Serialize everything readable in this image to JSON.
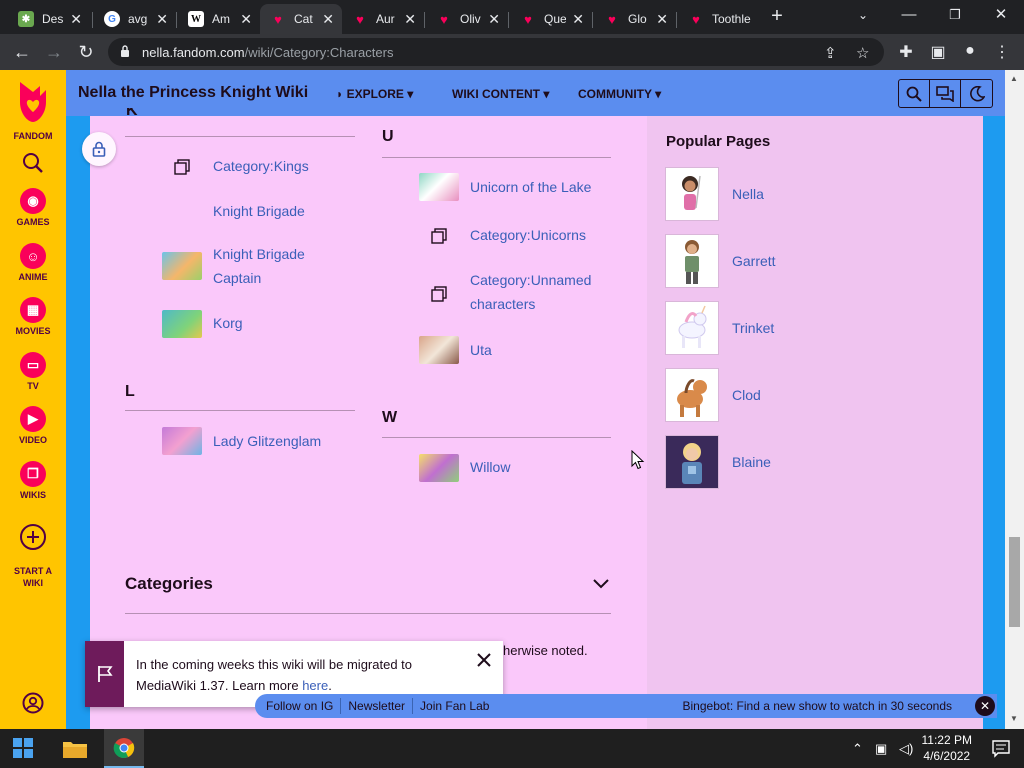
{
  "browser": {
    "tabs": [
      {
        "label": "Des",
        "fav_color": "#6aa84f",
        "fav_glyph": "✱"
      },
      {
        "label": "avg",
        "fav_color": "#ffffff",
        "fav_glyph": "G"
      },
      {
        "label": "Am",
        "fav_color": "#ffffff",
        "fav_glyph": "W"
      },
      {
        "label": "Cat",
        "fav_color": "#fa005a",
        "fav_glyph": "♥",
        "active": true
      },
      {
        "label": "Aur",
        "fav_color": "#fa005a",
        "fav_glyph": "♥"
      },
      {
        "label": "Oliv",
        "fav_color": "#fa005a",
        "fav_glyph": "♥"
      },
      {
        "label": "Que",
        "fav_color": "#fa005a",
        "fav_glyph": "♥"
      },
      {
        "label": "Glo",
        "fav_color": "#fa005a",
        "fav_glyph": "♥"
      },
      {
        "label": "Toothle",
        "fav_color": "#fa005a",
        "fav_glyph": "♥"
      }
    ],
    "url_host": "nella.fandom.com",
    "url_path": "/wiki/Category:Characters"
  },
  "rail": {
    "logo_label": "FANDOM",
    "items": [
      {
        "label": "GAMES"
      },
      {
        "label": "ANIME"
      },
      {
        "label": "MOVIES"
      },
      {
        "label": "TV"
      },
      {
        "label": "VIDEO"
      },
      {
        "label": "WIKIS"
      },
      {
        "label": "START A\nWIKI"
      }
    ]
  },
  "header": {
    "title": "Nella the Princess Knight Wiki",
    "nav": [
      "EXPLORE",
      "WIKI CONTENT",
      "COMMUNITY"
    ]
  },
  "category": {
    "col1": {
      "partial_letter": "K",
      "letter_l": "L",
      "k_items": [
        "Category:Kings",
        "Knight Brigade",
        "Knight Brigade Captain",
        "Korg"
      ],
      "l_items": [
        "Lady Glitzenglam"
      ]
    },
    "col2": {
      "letter_u": "U",
      "letter_w": "W",
      "u_items": [
        "Unicorn of the Lake",
        "Category:Unicorns",
        "Category:Unnamed characters",
        "Uta"
      ],
      "w_items": [
        "Willow"
      ]
    }
  },
  "categories_section": {
    "title": "Categories",
    "license_tail": "herwise noted."
  },
  "popular": {
    "title": "Popular Pages",
    "items": [
      "Nella",
      "Garrett",
      "Trinket",
      "Clod",
      "Blaine"
    ]
  },
  "notification": {
    "text": "In the coming weeks this wiki will be migrated to MediaWiki 1.37. Learn more ",
    "link": "here",
    "end": "."
  },
  "globalbar": {
    "links": [
      "Follow on IG",
      "Newsletter",
      "Join Fan Lab"
    ],
    "bingebot": "Bingebot: Find a new show to watch in 30 seconds"
  },
  "taskbar": {
    "time": "11:22 PM",
    "date": "4/6/2022"
  },
  "colors": {
    "fandom_pink": "#fa005a",
    "rail_yellow": "#ffc500",
    "header_blue": "#5b8def",
    "content_pink": "#fac8fa",
    "link_blue": "#3a5fb8"
  }
}
